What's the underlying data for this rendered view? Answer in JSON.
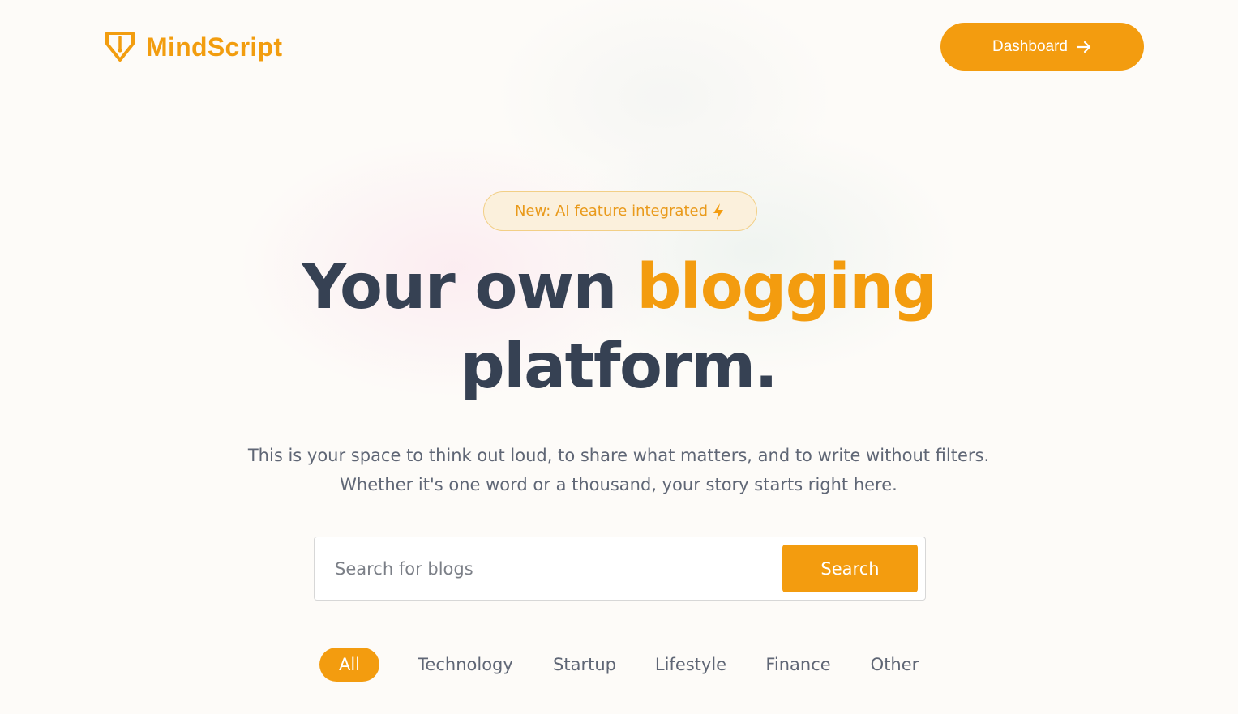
{
  "brand": {
    "name": "MindScript",
    "icon": "pen-nib-shield-icon",
    "color": "#f29d0f"
  },
  "nav": {
    "dashboard_label": "Dashboard",
    "dashboard_icon": "arrow-right-icon"
  },
  "hero": {
    "badge_text": "New: AI feature integrated",
    "badge_icon": "lightning-bolt-icon",
    "headline_part1": "Your own",
    "headline_accent": "blogging",
    "headline_part2": "platform.",
    "subtext": "This is your space to think out loud, to share what matters, and to write without filters. Whether it's one word or a thousand, your story starts right here."
  },
  "search": {
    "placeholder": "Search for blogs",
    "value": "",
    "button_label": "Search"
  },
  "categories": {
    "items": [
      "All",
      "Technology",
      "Startup",
      "Lifestyle",
      "Finance",
      "Other"
    ],
    "selected": "All"
  },
  "colors": {
    "accent": "#f39c0f",
    "heading": "#364153",
    "body_text": "#5f6675",
    "badge_bg": "#fbf0dc",
    "badge_border": "#f2cf86"
  }
}
